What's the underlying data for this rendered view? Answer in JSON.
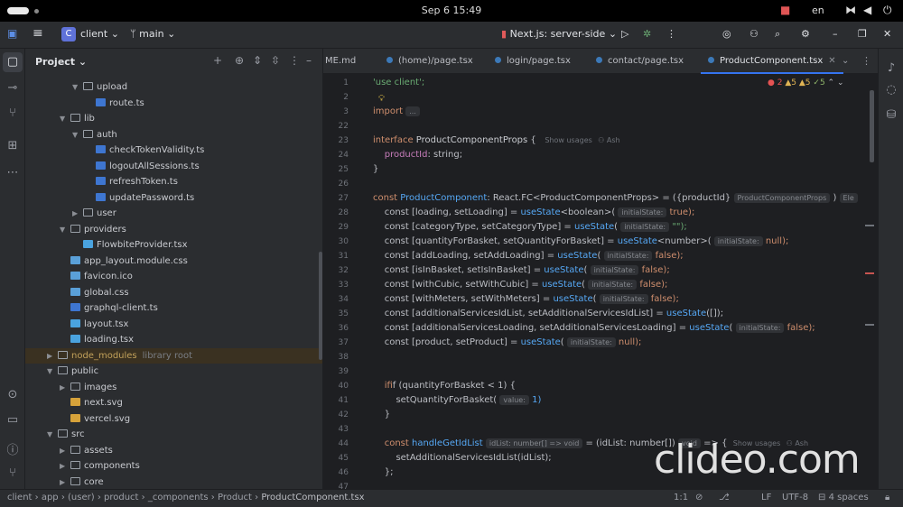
{
  "os": {
    "clock": "Sep 6  15:49",
    "language": "en"
  },
  "toolbar": {
    "project_badge": "C",
    "project_name": "client",
    "branch": "main",
    "run_config": "Next.js: server-side"
  },
  "project_panel": {
    "title": "Project",
    "tree": [
      {
        "label": "upload",
        "type": "folder",
        "indent": 3,
        "arrow": "down"
      },
      {
        "label": "route.ts",
        "type": "ts",
        "indent": 4,
        "arrow": ""
      },
      {
        "label": "lib",
        "type": "folder",
        "indent": 2,
        "arrow": "down"
      },
      {
        "label": "auth",
        "type": "folder",
        "indent": 3,
        "arrow": "down"
      },
      {
        "label": "checkTokenValidity.ts",
        "type": "ts",
        "indent": 4,
        "arrow": ""
      },
      {
        "label": "logoutAllSessions.ts",
        "type": "ts",
        "indent": 4,
        "arrow": ""
      },
      {
        "label": "refreshToken.ts",
        "type": "ts",
        "indent": 4,
        "arrow": ""
      },
      {
        "label": "updatePassword.ts",
        "type": "ts",
        "indent": 4,
        "arrow": ""
      },
      {
        "label": "user",
        "type": "folder",
        "indent": 3,
        "arrow": "right"
      },
      {
        "label": "providers",
        "type": "folder",
        "indent": 2,
        "arrow": "down"
      },
      {
        "label": "FlowbiteProvider.tsx",
        "type": "tsx",
        "indent": 3,
        "arrow": ""
      },
      {
        "label": "app_layout.module.css",
        "type": "css",
        "indent": 2,
        "arrow": ""
      },
      {
        "label": "favicon.ico",
        "type": "ico",
        "indent": 2,
        "arrow": ""
      },
      {
        "label": "global.css",
        "type": "css",
        "indent": 2,
        "arrow": ""
      },
      {
        "label": "graphql-client.ts",
        "type": "ts",
        "indent": 2,
        "arrow": ""
      },
      {
        "label": "layout.tsx",
        "type": "tsx",
        "indent": 2,
        "arrow": ""
      },
      {
        "label": "loading.tsx",
        "type": "tsx",
        "indent": 2,
        "arrow": ""
      },
      {
        "label": "node_modules",
        "type": "folder",
        "indent": 1,
        "arrow": "right",
        "note": "library root",
        "highlight": true
      },
      {
        "label": "public",
        "type": "folder",
        "indent": 1,
        "arrow": "down"
      },
      {
        "label": "images",
        "type": "folder",
        "indent": 2,
        "arrow": "right"
      },
      {
        "label": "next.svg",
        "type": "svg",
        "indent": 2,
        "arrow": ""
      },
      {
        "label": "vercel.svg",
        "type": "svg",
        "indent": 2,
        "arrow": ""
      },
      {
        "label": "src",
        "type": "folder",
        "indent": 1,
        "arrow": "down"
      },
      {
        "label": "assets",
        "type": "folder",
        "indent": 2,
        "arrow": "right"
      },
      {
        "label": "components",
        "type": "folder",
        "indent": 2,
        "arrow": "right"
      },
      {
        "label": "core",
        "type": "folder",
        "indent": 2,
        "arrow": "right"
      }
    ]
  },
  "editor": {
    "tabs": [
      {
        "label": "ME.md",
        "active": false
      },
      {
        "label": "(home)/page.tsx",
        "active": false
      },
      {
        "label": "login/page.tsx",
        "active": false
      },
      {
        "label": "contact/page.tsx",
        "active": false
      },
      {
        "label": "ProductComponent.tsx",
        "active": true
      }
    ],
    "inspections": {
      "errors": "2",
      "warnings": "5",
      "weak": "5",
      "typos": "5"
    },
    "line_numbers": [
      "1",
      "2",
      "3",
      "22",
      "23",
      "24",
      "25",
      "26",
      "27",
      "28",
      "29",
      "30",
      "31",
      "32",
      "33",
      "34",
      "35",
      "36",
      "37",
      "38",
      "39",
      "40",
      "41",
      "42",
      "43",
      "44",
      "45",
      "46",
      "47"
    ],
    "hints": {
      "usages": "Show usages",
      "author": "Ash",
      "props_type": "ProductComponentProps",
      "props_type_tail": "Ele",
      "initial_state": "initialState:",
      "value": "value:",
      "idlist_type": "idList: number[] => void",
      "void": "void"
    },
    "code": {
      "l1": "'use client';",
      "l3_kw": "import",
      "l3_fold": "...",
      "l22_kw": "interface",
      "l22_name": "ProductComponentProps",
      "l22_brace": " {",
      "l23_prop": "productId",
      "l23_rest": ": string;",
      "l24": "}",
      "l26_kw": "const",
      "l26_name": "ProductComponent",
      "l26_rest": ": React.FC<ProductComponentProps> = ({productId}",
      "l26_end": ") ",
      "s_loading": "const [loading, setLoading] = ",
      "s_loading_fn": "useState",
      "s_loading_gen": "<boolean>(",
      "s_loading_val": "true);",
      "s_cat": "const [categoryType, setCategoryType] = ",
      "s_cat_val": "\"\");",
      "s_qty": "const [quantityForBasket, setQuantityForBasket] = ",
      "s_qty_gen": "<number>(",
      "s_qty_val": "null);",
      "s_add": "const [addLoading, setAddLoading] = ",
      "s_inbasket": "const [isInBasket, setIsInBasket] = ",
      "s_cubic": "const [withCubic, setWithCubic] = ",
      "s_meters": "const [withMeters, setWithMeters] = ",
      "s_ids": "const [additionalServicesIdList, setAdditionalServicesIdList] = ",
      "s_ids_val": "([]);",
      "s_idsload": "const [additionalServicesLoading, setAdditionalServicesLoading] = ",
      "s_product": "const [product, setProduct] = ",
      "false_val": "false);",
      "open_paren": "(",
      "if_line": "if (quantityForBasket < 1) {",
      "set_qty": "setQuantityForBasket(",
      "set_qty_val": "1)",
      "close_brace": "}",
      "handle_kw": "const",
      "handle_name": "handleGetIdList",
      "handle_rest": " = (idList: number[])",
      "handle_arrow": " => {",
      "set_ids": "setAdditionalServicesIdList(idList);",
      "end": "};"
    }
  },
  "status": {
    "breadcrumb": [
      "client",
      "app",
      "(user)",
      "product",
      "_components",
      "Product",
      "ProductComponent.tsx"
    ],
    "position": "1:1",
    "line_sep": "LF",
    "encoding": "UTF-8",
    "indent": "4 spaces"
  },
  "watermark": "clideo.com",
  "colors": {
    "background": "#1e1f22",
    "panel": "#2b2d30",
    "accent": "#3574f0",
    "keyword": "#cf8e6d",
    "string": "#6aab73",
    "function": "#56a8f5"
  }
}
